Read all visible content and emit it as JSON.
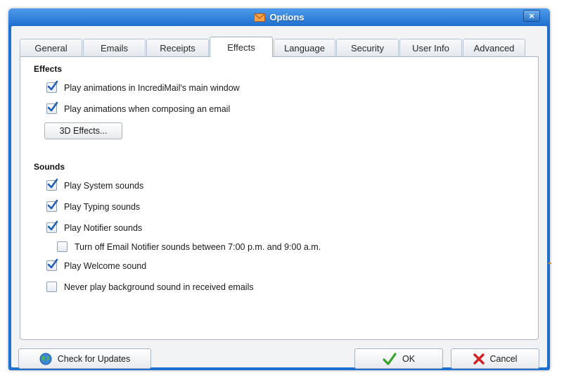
{
  "window": {
    "title": "Options",
    "close_label": "×"
  },
  "tabs": [
    {
      "label": "General"
    },
    {
      "label": "Emails"
    },
    {
      "label": "Receipts"
    },
    {
      "label": "Effects"
    },
    {
      "label": "Language"
    },
    {
      "label": "Security"
    },
    {
      "label": "User Info"
    },
    {
      "label": "Advanced"
    }
  ],
  "active_tab": "Effects",
  "effects": {
    "title": "Effects",
    "options": [
      {
        "label": "Play animations in IncrediMail's main window",
        "checked": true
      },
      {
        "label": "Play animations when composing an email",
        "checked": true
      }
    ],
    "button_3d": "3D Effects..."
  },
  "sounds": {
    "title": "Sounds",
    "options": [
      {
        "label": "Play System sounds",
        "checked": true
      },
      {
        "label": "Play Typing sounds",
        "checked": true
      },
      {
        "label": "Play Notifier sounds",
        "checked": true
      },
      {
        "label": "Turn off Email Notifier sounds between 7:00 p.m. and 9:00 a.m.",
        "checked": false
      },
      {
        "label": "Play Welcome sound",
        "checked": true
      },
      {
        "label": "Never play background sound in received emails",
        "checked": false
      }
    ]
  },
  "footer": {
    "check_updates": "Check for Updates",
    "ok": "OK",
    "cancel": "Cancel"
  },
  "colors": {
    "titlebar": "#2a7ad8",
    "check": "#1f5fb4",
    "ok_icon": "#3aa12a",
    "cancel_icon": "#d42020"
  },
  "icons": {
    "title": "envelope-icon",
    "check_updates": "globe-icon",
    "ok": "checkmark-icon",
    "cancel": "x-icon"
  }
}
